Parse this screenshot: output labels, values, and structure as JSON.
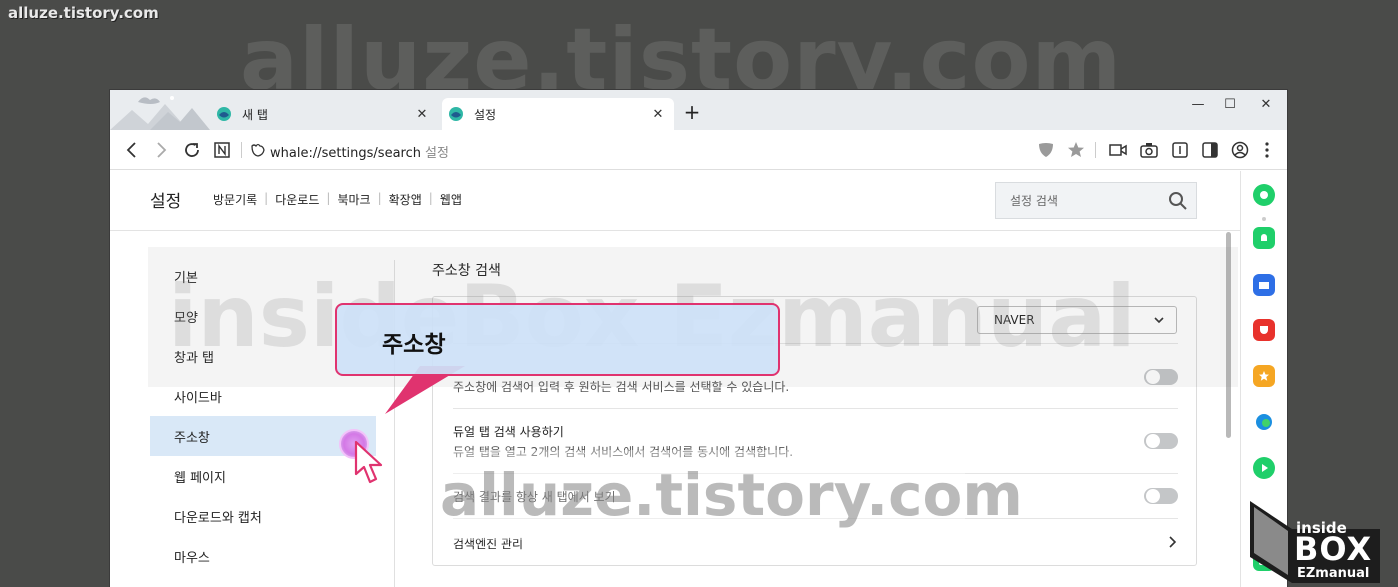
{
  "watermarks": {
    "top_left": "alluze.tistory.com",
    "big_top": "alluze.tistory.com",
    "inside_box": "insideBox Ezmanual",
    "middle": "alluze.tistory.com"
  },
  "browser": {
    "tabs": [
      {
        "title": "새 탭",
        "active": false
      },
      {
        "title": "설정",
        "active": true
      }
    ],
    "new_tab_symbol": "+",
    "url": "whale://settings/search",
    "url_suffix": "설정"
  },
  "settings_header": {
    "title": "설정",
    "nav": [
      "방문기록",
      "다운로드",
      "북마크",
      "확장앱",
      "웹앱"
    ],
    "search_placeholder": "설정 검색"
  },
  "sidebar": {
    "items": [
      {
        "label": "기본",
        "active": false
      },
      {
        "label": "모양",
        "active": false
      },
      {
        "label": "창과 탭",
        "active": false
      },
      {
        "label": "사이드바",
        "active": false
      },
      {
        "label": "주소창",
        "active": true
      },
      {
        "label": "웹 페이지",
        "active": false
      },
      {
        "label": "다운로드와 캡처",
        "active": false
      },
      {
        "label": "마우스",
        "active": false
      }
    ]
  },
  "main": {
    "section_title": "주소창 검색",
    "engine_select_value": "NAVER",
    "rows": [
      {
        "desc": "주소창에 검색어 입력 후 원하는 검색 서비스를 선택할 수 있습니다.",
        "toggle": false
      },
      {
        "title": "듀얼 탭 검색 사용하기",
        "desc": "듀얼 탭을 열고 2개의 검색 서비스에서 검색어를 동시에 검색합니다.",
        "toggle": false
      },
      {
        "title": "검색 결과를 항상 새 탭에서 보기",
        "toggle": false
      },
      {
        "title": "검색엔진 관리"
      }
    ]
  },
  "callout": {
    "text": "주소창"
  },
  "logo": {
    "top": "inside",
    "middle": "BOX",
    "bottom": "EZmanual"
  },
  "colors": {
    "accent_pink": "#e0336f",
    "sidebar_active": "#d9e8f7",
    "background": "#4a4b49"
  }
}
